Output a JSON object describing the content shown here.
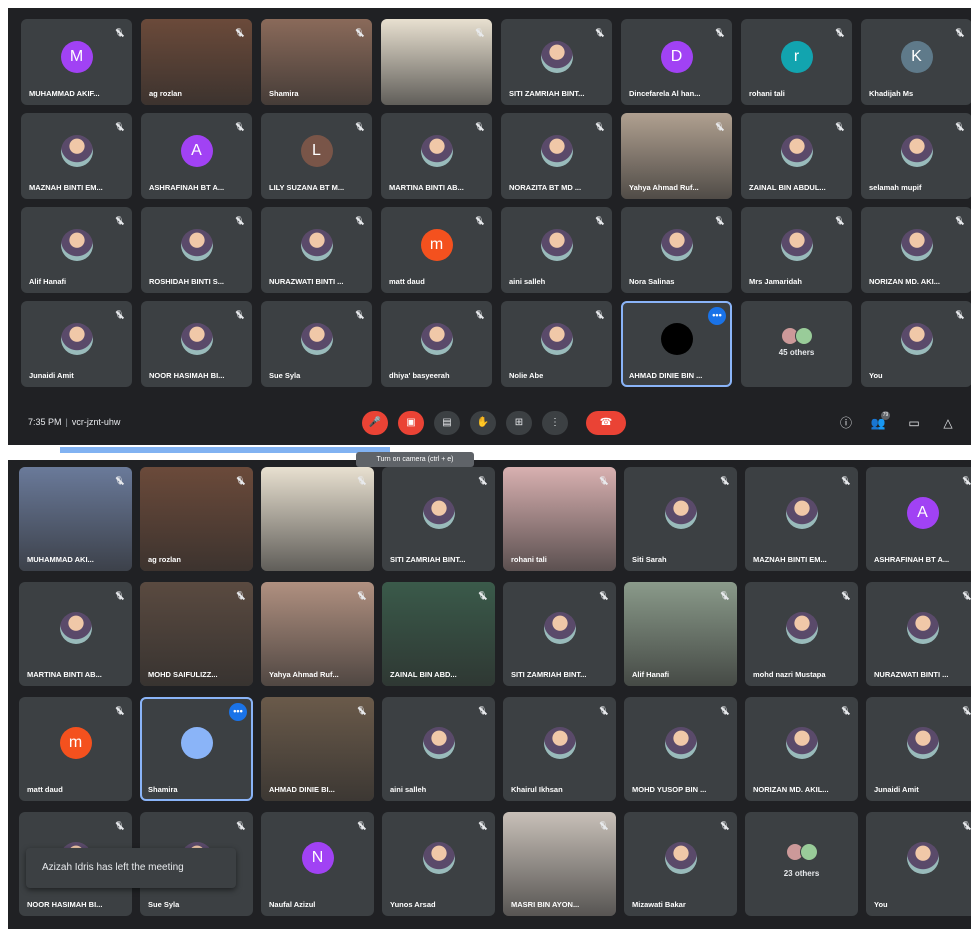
{
  "top_screen": {
    "time": "7:35 PM",
    "meeting_code": "vcr-jznt-uhw",
    "participant_count_badge": "79",
    "others_label": "45 others",
    "tiles": [
      {
        "name": "MUHAMMAD AKIF...",
        "initial": "M",
        "color": "#a142f4"
      },
      {
        "name": "ag rozlan",
        "video": true,
        "vcolor": "#6b4a3a"
      },
      {
        "name": "Shamira",
        "video": true,
        "vcolor": "#8a6a5a"
      },
      {
        "name": "",
        "video": true,
        "vcolor": "#e8e0d0"
      },
      {
        "name": "SITI ZAMRIAH BINT...",
        "photo": true
      },
      {
        "name": "Dincefarela Al han...",
        "initial": "D",
        "color": "#a142f4"
      },
      {
        "name": "rohani tali",
        "initial": "r",
        "color": "#12a4af"
      },
      {
        "name": "Khadijah Ms",
        "initial": "K",
        "color": "#5f7a8a"
      },
      {
        "name": "MAZNAH BINTI EM...",
        "photo": true
      },
      {
        "name": "ASHRAFINAH BT A...",
        "initial": "A",
        "color": "#a142f4"
      },
      {
        "name": "LILY SUZANA BT M...",
        "initial": "L",
        "color": "#795548"
      },
      {
        "name": "MARTINA BINTI AB...",
        "photo": true
      },
      {
        "name": "NORAZITA BT MD ...",
        "photo": true
      },
      {
        "name": "Yahya Ahmad Ruf...",
        "video": true,
        "vcolor": "#b0a090"
      },
      {
        "name": "ZAINAL BIN ABDUL...",
        "photo": true
      },
      {
        "name": "selamah mupif",
        "photo": true
      },
      {
        "name": "Alif Hanafi",
        "photo": true
      },
      {
        "name": "ROSHIDAH BINTI S...",
        "photo": true
      },
      {
        "name": "NURAZWATI BINTI ...",
        "photo": true
      },
      {
        "name": "matt daud",
        "initial": "m",
        "color": "#f4511e"
      },
      {
        "name": "aini salleh",
        "photo": true
      },
      {
        "name": "Nora Salinas",
        "photo": true
      },
      {
        "name": "Mrs Jamaridah",
        "photo": true
      },
      {
        "name": "NORIZAN MD. AKI...",
        "photo": true
      },
      {
        "name": "Junaidi Amit",
        "photo": true
      },
      {
        "name": "NOOR HASIMAH BI...",
        "photo": true
      },
      {
        "name": "Sue Syla",
        "photo": true
      },
      {
        "name": "dhiya' basyeerah",
        "photo": true
      },
      {
        "name": "Nolie Abe",
        "photo": true
      },
      {
        "name": "AHMAD DINIE BIN ...",
        "initial": "",
        "color": "#000000",
        "speaking": true
      },
      {
        "name": "",
        "others": true
      },
      {
        "name": "You",
        "photo": true
      }
    ]
  },
  "bottom_screen": {
    "others_label": "23 others",
    "toast": "Azizah Idris has left the meeting",
    "tooltip": "Turn on camera (ctrl + e)",
    "tiles": [
      {
        "name": "MUHAMMAD AKI...",
        "video": true,
        "vcolor": "#6a7a9a"
      },
      {
        "name": "ag rozlan",
        "video": true,
        "vcolor": "#6b4a3a"
      },
      {
        "name": "",
        "video": true,
        "vcolor": "#e8e0d0"
      },
      {
        "name": "SITI ZAMRIAH BINT...",
        "photo": true
      },
      {
        "name": "rohani tali",
        "video": true,
        "vcolor": "#d8b0b0"
      },
      {
        "name": "Siti Sarah",
        "photo": true
      },
      {
        "name": "MAZNAH BINTI EM...",
        "photo": true
      },
      {
        "name": "ASHRAFINAH BT A...",
        "initial": "A",
        "color": "#a142f4"
      },
      {
        "name": "MARTINA BINTI AB...",
        "photo": true
      },
      {
        "name": "MOHD SAIFULIZZ...",
        "video": true,
        "vcolor": "#5a4a40"
      },
      {
        "name": "Yahya Ahmad Ruf...",
        "video": true,
        "vcolor": "#b09080"
      },
      {
        "name": "ZAINAL BIN ABD...",
        "video": true,
        "vcolor": "#3a5a4a"
      },
      {
        "name": "SITI ZAMRIAH BINT...",
        "photo": true
      },
      {
        "name": "Alif Hanafi",
        "video": true,
        "vcolor": "#8a9a8a"
      },
      {
        "name": "mohd nazri Mustapa",
        "photo": true
      },
      {
        "name": "NURAZWATI BINTI ...",
        "photo": true
      },
      {
        "name": "matt daud",
        "initial": "m",
        "color": "#f4511e"
      },
      {
        "name": "Shamira",
        "initial": "",
        "color": "#8ab4f8",
        "speaking": true
      },
      {
        "name": "AHMAD DINIE BI...",
        "video": true,
        "vcolor": "#6a5a4a"
      },
      {
        "name": "aini salleh",
        "photo": true
      },
      {
        "name": "Khairul Ikhsan",
        "photo": true
      },
      {
        "name": "MOHD YUSOP BIN ...",
        "photo": true
      },
      {
        "name": "NORIZAN MD. AKIL...",
        "photo": true
      },
      {
        "name": "Junaidi Amit",
        "photo": true
      },
      {
        "name": "NOOR HASIMAH BI...",
        "photo": true
      },
      {
        "name": "Sue Syla",
        "photo": true
      },
      {
        "name": "Naufal Azizul",
        "initial": "N",
        "color": "#a142f4"
      },
      {
        "name": "Yunos Arsad",
        "photo": true
      },
      {
        "name": "MASRI BIN AYON...",
        "video": true,
        "vcolor": "#c8c0b8"
      },
      {
        "name": "Mizawati Bakar",
        "photo": true
      },
      {
        "name": "",
        "others": true
      },
      {
        "name": "You",
        "photo": true
      }
    ]
  },
  "controls": {
    "mic_icon": "mic-off-icon",
    "camera_icon": "camera-off-icon",
    "captions_icon": "captions-icon",
    "hand_icon": "raise-hand-icon",
    "present_icon": "present-icon",
    "more_icon": "more-options-icon",
    "hangup_icon": "hang-up-icon",
    "accent": "#ea4335"
  }
}
